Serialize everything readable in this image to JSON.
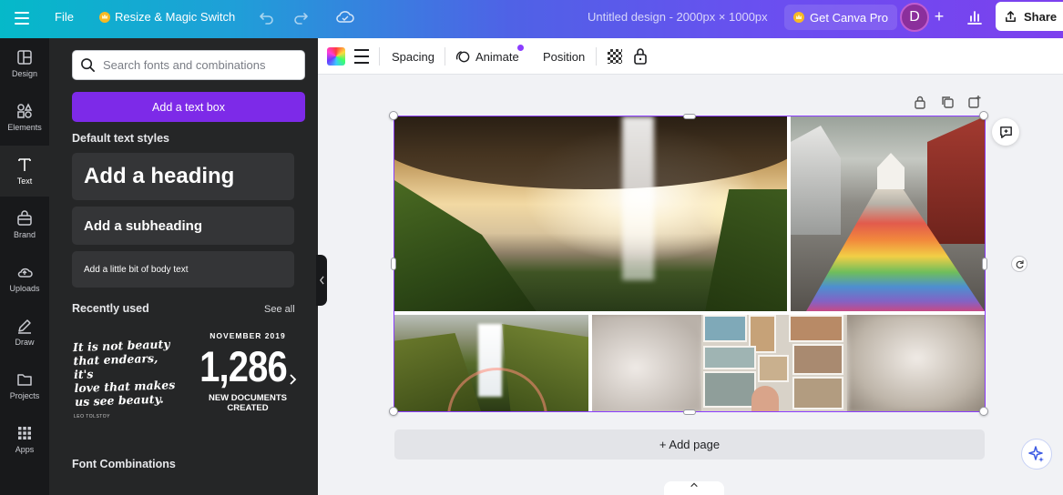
{
  "topbar": {
    "file_label": "File",
    "resize_label": "Resize & Magic Switch",
    "doc_title": "Untitled design - 2000px × 1000px",
    "get_pro_label": "Get Canva Pro",
    "avatar_initial": "D",
    "share_label": "Share"
  },
  "rail": {
    "items": [
      {
        "label": "Design",
        "icon": "layout-icon"
      },
      {
        "label": "Elements",
        "icon": "shapes-icon"
      },
      {
        "label": "Text",
        "icon": "text-t-icon",
        "active": true
      },
      {
        "label": "Brand",
        "icon": "brand-bag-icon"
      },
      {
        "label": "Uploads",
        "icon": "cloud-upload-icon"
      },
      {
        "label": "Draw",
        "icon": "pen-icon"
      },
      {
        "label": "Projects",
        "icon": "folder-icon"
      },
      {
        "label": "Apps",
        "icon": "grid-icon"
      }
    ]
  },
  "panel": {
    "search_placeholder": "Search fonts and combinations",
    "add_text_box_label": "Add a text box",
    "default_styles_title": "Default text styles",
    "heading_label": "Add a heading",
    "subheading_label": "Add a subheading",
    "body_label": "Add a little bit of body text",
    "recently_used_title": "Recently used",
    "see_all_label": "See all",
    "quote_text": "It is not beauty\nthat endears, it's\nlove that makes\nus see beauty.",
    "quote_author": "LEO TOLSTOY",
    "stat_top": "NOVEMBER 2019",
    "stat_number": "1,286",
    "stat_bottom": "NEW DOCUMENTS CREATED",
    "font_combinations_title": "Font Combinations"
  },
  "context_toolbar": {
    "spacing_label": "Spacing",
    "animate_label": "Animate",
    "position_label": "Position"
  },
  "canvas": {
    "add_page_label": "+ Add page"
  },
  "colors": {
    "accent_purple": "#8b3dff",
    "button_purple": "#7d2ae8",
    "panel_bg": "#252627",
    "rail_bg": "#18191b"
  }
}
